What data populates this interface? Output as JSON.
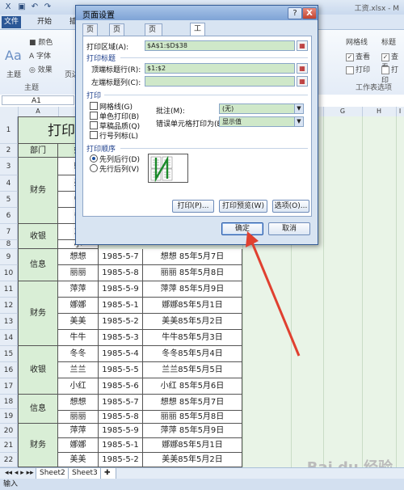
{
  "app": {
    "title": "工资.xlsx - M",
    "ribbon_tabs": [
      "文件",
      "开始",
      "插入"
    ],
    "name_box": "A1",
    "font_group_items": [
      "颜色",
      "字体",
      "效果"
    ],
    "theme_label": "主题",
    "group_label": "主题",
    "page_margin_label": "页边距",
    "gridlines_label": "网格线",
    "heading_label": "标题",
    "view_label": "查看",
    "print_label": "打印",
    "sheet_options_label": "工作表选项"
  },
  "columns": [
    "A",
    "B",
    "C",
    "D",
    "E",
    "F",
    "G",
    "H",
    "I"
  ],
  "rows": [
    "1",
    "2",
    "3",
    "4",
    "5",
    "6",
    "7",
    "8",
    "9",
    "10",
    "11",
    "12",
    "13",
    "14",
    "15",
    "16",
    "17",
    "18",
    "19",
    "20",
    "21",
    "22",
    "23"
  ],
  "sheet": {
    "title_partial": "打印|",
    "header": [
      "部门",
      "姓"
    ],
    "dept_cells": [
      "财务",
      "收银",
      "信息",
      "财务",
      "收银",
      "信息",
      "财务"
    ],
    "partial_names": [
      "娜",
      "美",
      "牛",
      "冬",
      "兰",
      "小"
    ],
    "data_rows": [
      {
        "name": "想想",
        "date": "1985-5-7",
        "label": "想想 85年5月7日"
      },
      {
        "name": "丽丽",
        "date": "1985-5-8",
        "label": "丽丽 85年5月8日"
      },
      {
        "name": "萍萍",
        "date": "1985-5-9",
        "label": "萍萍 85年5月9日"
      },
      {
        "name": "娜娜",
        "date": "1985-5-1",
        "label": "娜娜85年5月1日"
      },
      {
        "name": "美美",
        "date": "1985-5-2",
        "label": "美美85年5月2日"
      },
      {
        "name": "牛牛",
        "date": "1985-5-3",
        "label": "牛牛85年5月3日"
      },
      {
        "name": "冬冬",
        "date": "1985-5-4",
        "label": "冬冬85年5月4日"
      },
      {
        "name": "兰兰",
        "date": "1985-5-5",
        "label": "兰兰85年5月5日"
      },
      {
        "name": "小红",
        "date": "1985-5-6",
        "label": "小红 85年5月6日"
      },
      {
        "name": "想想",
        "date": "1985-5-7",
        "label": "想想 85年5月7日"
      },
      {
        "name": "丽丽",
        "date": "1985-5-8",
        "label": "丽丽 85年5月8日"
      },
      {
        "name": "萍萍",
        "date": "1985-5-9",
        "label": "萍萍 85年5月9日"
      },
      {
        "name": "娜娜",
        "date": "1985-5-1",
        "label": "娜娜85年5月1日"
      },
      {
        "name": "美美",
        "date": "1985-5-2",
        "label": "美美85年5月2日"
      },
      {
        "name": "牛牛",
        "date": "1985-5-3",
        "label": "牛牛85年5月3日"
      },
      {
        "name": "冬冬",
        "date": "1985-5-4",
        "label": "冬冬85年5月4日"
      }
    ],
    "tabs": [
      "Sheet2",
      "Sheet3"
    ],
    "status": "输入",
    "watermark": "Bai du 经验"
  },
  "dialog": {
    "title": "页面设置",
    "help": "?",
    "close": "X",
    "tabs": [
      "页面",
      "页边距",
      "页眉/页脚",
      "工作表"
    ],
    "active_tab": "工作表",
    "print_area_label": "打印区域(A):",
    "print_area_value": "$A$1:$D$38",
    "print_titles_section": "打印标题",
    "top_rows_label": "顶端标题行(R):",
    "top_rows_value": "$1:$2",
    "left_cols_label": "左端标题列(C):",
    "left_cols_value": "",
    "print_section": "打印",
    "checkboxes": [
      "网格线(G)",
      "单色打印(B)",
      "草稿品质(Q)",
      "行号列标(L)"
    ],
    "comments_label": "批注(M):",
    "comments_value": "(无)",
    "errors_label": "错误单元格打印为(E):",
    "errors_value": "显示值",
    "order_section": "打印顺序",
    "order_options": [
      "先列后行(D)",
      "先行后列(V)"
    ],
    "order_selected": "先列后行(D)",
    "buttons": {
      "print": "打印(P)...",
      "preview": "打印预览(W)",
      "options": "选项(O)...",
      "ok": "确定",
      "cancel": "取消"
    }
  },
  "colors": {
    "sheet_fill": "#d9eed6",
    "dialog_bg": "#d8e4f2",
    "arrow": "#e04030"
  }
}
